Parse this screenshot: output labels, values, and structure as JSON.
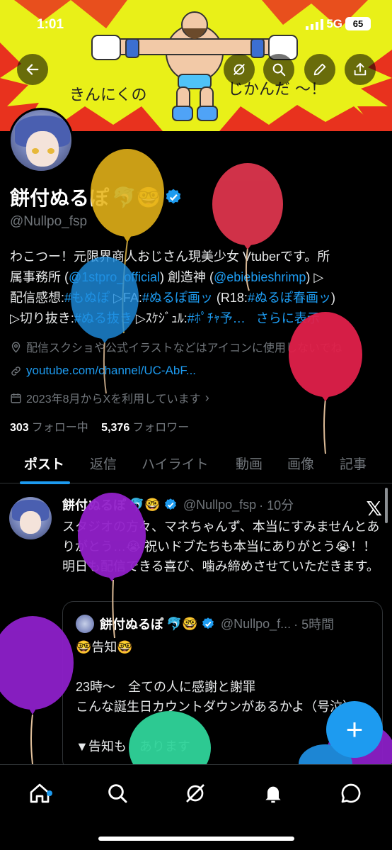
{
  "status_bar": {
    "time": "1:01",
    "network": "5G",
    "battery": "65"
  },
  "banner": {
    "caption_left": "きんにくの",
    "caption_right": "じかんだ ～！"
  },
  "profile": {
    "display_name": "餅付ぬるぽ",
    "name_emojis": "🐬🤓",
    "handle": "@Nullpo_fsp",
    "bio_line1": "わこつー！元限界商人おじさん現美少女 Vtuberです。所",
    "bio_line2_a": "属事務所 (",
    "bio_link1": "@1stpro_official",
    "bio_line2_b": ") 創造神 (",
    "bio_link2": "@ebiebieshrimp",
    "bio_line2_c": ") ▷",
    "bio_line3_a": "配信感想:",
    "bio_tag1": "#もぬぽ",
    "bio_line3_b": " ▷FA:",
    "bio_tag2": "#ぬるぽ画ッ",
    "bio_line3_c": " (R18:",
    "bio_tag3": "#ぬるぽ春画ッ",
    "bio_line3_d": ")",
    "bio_line4_a": "▷切り抜き:",
    "bio_tag4": "#ぬる抜き",
    "bio_line4_b": " ▷ｽｹｼﾞｭﾙ:",
    "bio_tag5": "#ﾎﾟﾁｬ予…",
    "bio_more": "さらに表示",
    "location": "配信スクショや公式イラストなどはアイコンに使用しないでね",
    "website": "youtube.com/channel/UC-AbF...",
    "joined": "2023年8月からXを利用しています",
    "following_count": "303",
    "following_label": "フォロー中",
    "followers_count": "5,376",
    "followers_label": "フォロワー"
  },
  "tabs": [
    "ポスト",
    "返信",
    "ハイライト",
    "動画",
    "画像",
    "記事"
  ],
  "post": {
    "name": "餅付ぬるぽ",
    "emojis": "🐬🤓",
    "handle": "@Nullpo_fsp",
    "time": "· 10分",
    "text": "スタジオの方々、マネちゃんず、本当にすみませんとありがとう…😭 祝いドブたちも本当にありがとう😭！！明日も配信できる喜び、噛み締めさせていただきます。",
    "quote": {
      "name": "餅付ぬるぽ",
      "emojis": "🐬🤓",
      "handle": "@Nullpo_f...",
      "time": "· 5時間",
      "text": "🤓告知🤓\n\n23時～　全ての人に感謝と謝罪\nこんな誕生日カウントダウンがあるかよ（号泣）\n\n▼告知も　あります"
    }
  },
  "fab_label": "+",
  "colors": {
    "accent": "#1d9bf0",
    "banner": "#e9f018",
    "burst": "#e8321e"
  }
}
